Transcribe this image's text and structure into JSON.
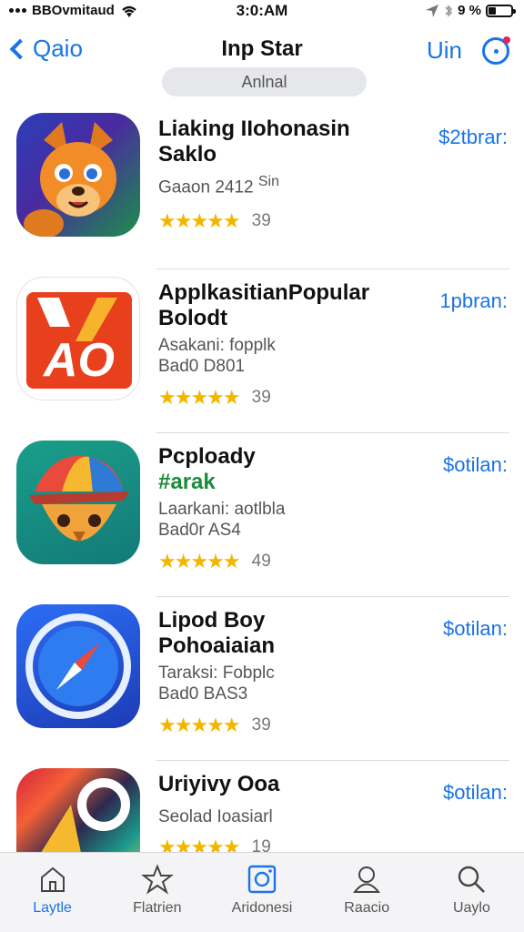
{
  "status_bar": {
    "carrier": "BBOvmitaud",
    "time": "3:0:AM",
    "battery_pct": "9 %"
  },
  "nav": {
    "back_label": "Qaio",
    "title": "Inp Star",
    "right_label": "Uin",
    "segment_label": "Anlnal"
  },
  "apps": [
    {
      "name": "Liaking IIohonasin",
      "name2": "Saklo",
      "sub": "Gaaon 2412",
      "sub_extra": "Sin",
      "stars": "★★★★★",
      "rating": "39",
      "get_label": "$2tbrar:",
      "icon": "fox-icon"
    },
    {
      "name": "ApplkasitianPopular",
      "name2": "Bolodt",
      "sub": "Asakani: fopplk",
      "sub2": "Bad0 D801",
      "stars": "★★★★★",
      "rating": "39",
      "get_label": "1pbran:",
      "icon": "ao-icon"
    },
    {
      "name": "Pcploady",
      "tag": "#arak",
      "sub": "Laarkani: aotlbla",
      "sub2": "Bad0r AS4",
      "stars": "★★★★★",
      "rating": "49",
      "get_label": "$otilan:",
      "icon": "bird-icon"
    },
    {
      "name": "Lipod Boy",
      "name2": "Pohoaiaian",
      "sub": "Taraksi: Fobplc",
      "sub2": "Bad0 BAS3",
      "stars": "★★★★★",
      "rating": "39",
      "get_label": "$otilan:",
      "icon": "compass-icon"
    },
    {
      "name": "Uriyivy Ooa",
      "sub": "Seolad Ioasiarl",
      "stars": "★★★★★",
      "rating": "19",
      "get_label": "$otilan:",
      "icon": "colorful-icon"
    }
  ],
  "tabs": [
    {
      "label": "Laytle",
      "icon": "home-icon"
    },
    {
      "label": "Flatrien",
      "icon": "star-icon"
    },
    {
      "label": "Aridonesi",
      "icon": "photo-icon"
    },
    {
      "label": "Raacio",
      "icon": "person-icon"
    },
    {
      "label": "Uaylo",
      "icon": "search-icon"
    }
  ],
  "colors": {
    "accent": "#1a73e8",
    "star": "#f2b600",
    "tag_green": "#1a8c3a"
  }
}
